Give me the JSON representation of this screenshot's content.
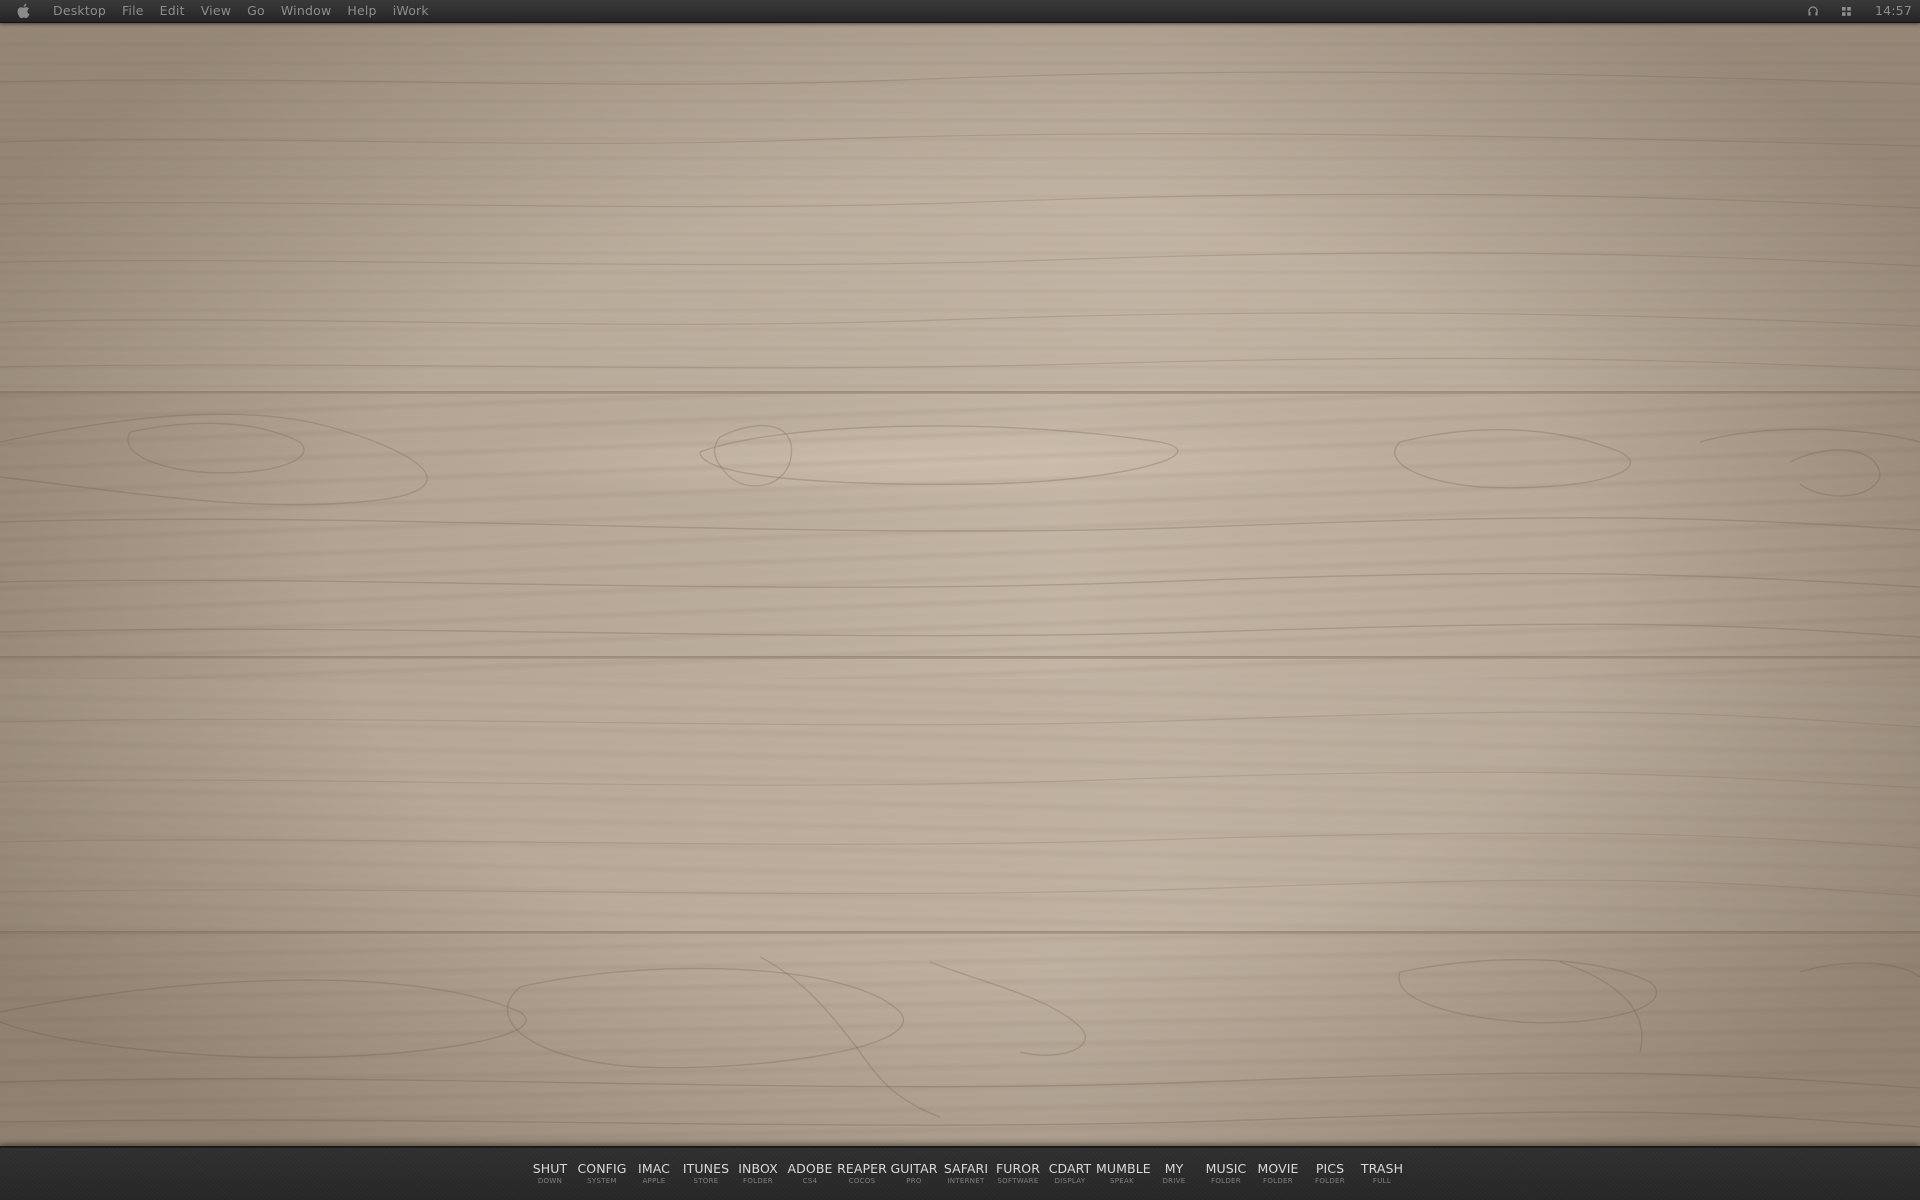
{
  "menubar": {
    "apple_icon": "apple-icon",
    "items": [
      "Desktop",
      "File",
      "Edit",
      "View",
      "Go",
      "Window",
      "Help",
      "iWork"
    ],
    "status_icons": [
      "headphones-icon",
      "app-grid-icon"
    ],
    "clock": "14:57"
  },
  "wallpaper": {
    "description_colors": {
      "light_wood": "#c3b5a5",
      "dark_grain": "#8a7a69"
    }
  },
  "dock": {
    "items": [
      {
        "title": "SHUT",
        "subtitle": "DOWN"
      },
      {
        "title": "CONFIG",
        "subtitle": "SYSTEM"
      },
      {
        "title": "IMAC",
        "subtitle": "APPLE"
      },
      {
        "title": "ITUNES",
        "subtitle": "STORE"
      },
      {
        "title": "INBOX",
        "subtitle": "FOLDER"
      },
      {
        "title": "ADOBE",
        "subtitle": "CS4"
      },
      {
        "title": "REAPER",
        "subtitle": "COCOS"
      },
      {
        "title": "GUITAR",
        "subtitle": "PRO"
      },
      {
        "title": "SAFARI",
        "subtitle": "INTERNET"
      },
      {
        "title": "FUROR",
        "subtitle": "SOFTWARE"
      },
      {
        "title": "CDART",
        "subtitle": "DISPLAY"
      },
      {
        "title": "MUMBLE",
        "subtitle": "SPEAK"
      },
      {
        "title": "MY",
        "subtitle": "DRIVE"
      },
      {
        "title": "MUSIC",
        "subtitle": "FOLDER"
      },
      {
        "title": "MOVIE",
        "subtitle": "FOLDER"
      },
      {
        "title": "PICS",
        "subtitle": "FOLDER"
      },
      {
        "title": "TRASH",
        "subtitle": "FULL"
      }
    ]
  }
}
